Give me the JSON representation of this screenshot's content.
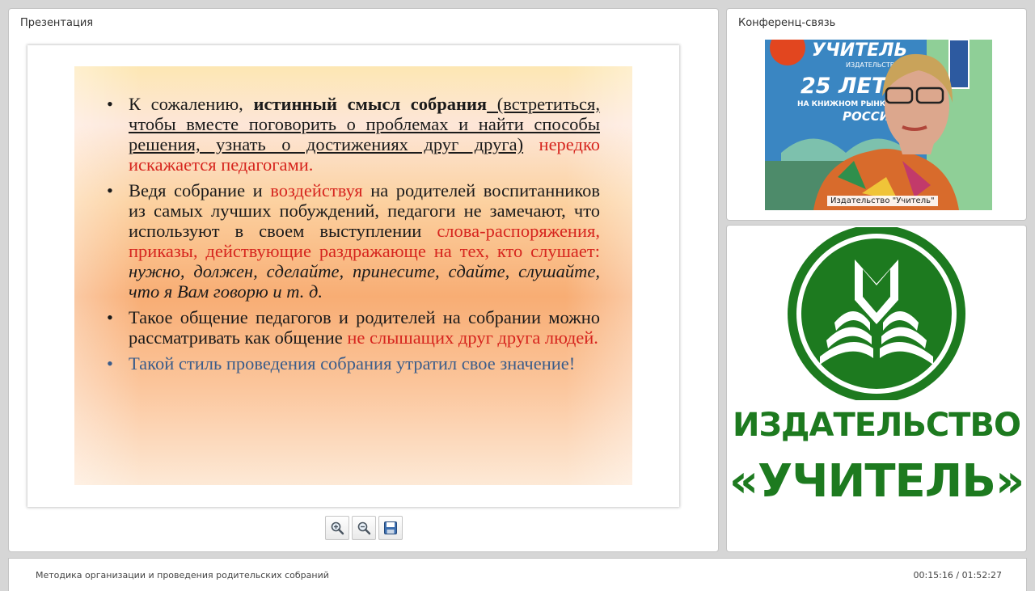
{
  "presentation": {
    "title": "Презентация",
    "slide": {
      "b1_intro": "К сожалению, ",
      "b1_bold": "истинный смысл собрания",
      "b1_underline": " (встретиться, чтобы вместе поговорить о проблемах и найти способы решения, узнать о достижениях друг друга)",
      "b1_red": " нередко искажается педагогами.",
      "b2_a": "Ведя собрание и ",
      "b2_red1": "воздействуя",
      "b2_b": " на родителей воспитанников из самых лучших побуждений, педагоги не замечают, что используют в своем выступлении ",
      "b2_red2": "слова-распоряжения, приказы, действующие раздражающе на тех, кто слушает:",
      "b2_italic": " нужно, должен, сделайте, принесите, сдайте, слушайте, что я Вам говорю и т. д.",
      "b3_a": "Такое общение педагогов и родителей на собрании можно рассматривать как общение ",
      "b3_red": "не слышащих друг друга людей.",
      "b4": "Такой стиль проведения собрания утратил свое значение!"
    },
    "toolbar": {
      "zoom_in_icon": "zoom-in-icon",
      "zoom_out_icon": "zoom-out-icon",
      "save_icon": "save-icon"
    }
  },
  "conference": {
    "title": "Конференц-связь",
    "video_caption": "Издательство \"Учитель\"",
    "banner_top": "УЧИТЕЛЬ",
    "banner_sub": "ИЗДАТЕЛЬСТВО",
    "banner_years": "25 ЛЕТ",
    "banner_line": "НА КНИЖНОМ РЫНКЕ",
    "banner_country": "РОССИ"
  },
  "logo": {
    "line1": "ИЗДАТЕЛЬСТВО",
    "line2": "«УЧИТЕЛЬ»",
    "color": "#1d7a1f"
  },
  "statusbar": {
    "course_title": "Методика организации и проведения родительских собраний",
    "time": "00:15:16 / 01:52:27"
  }
}
